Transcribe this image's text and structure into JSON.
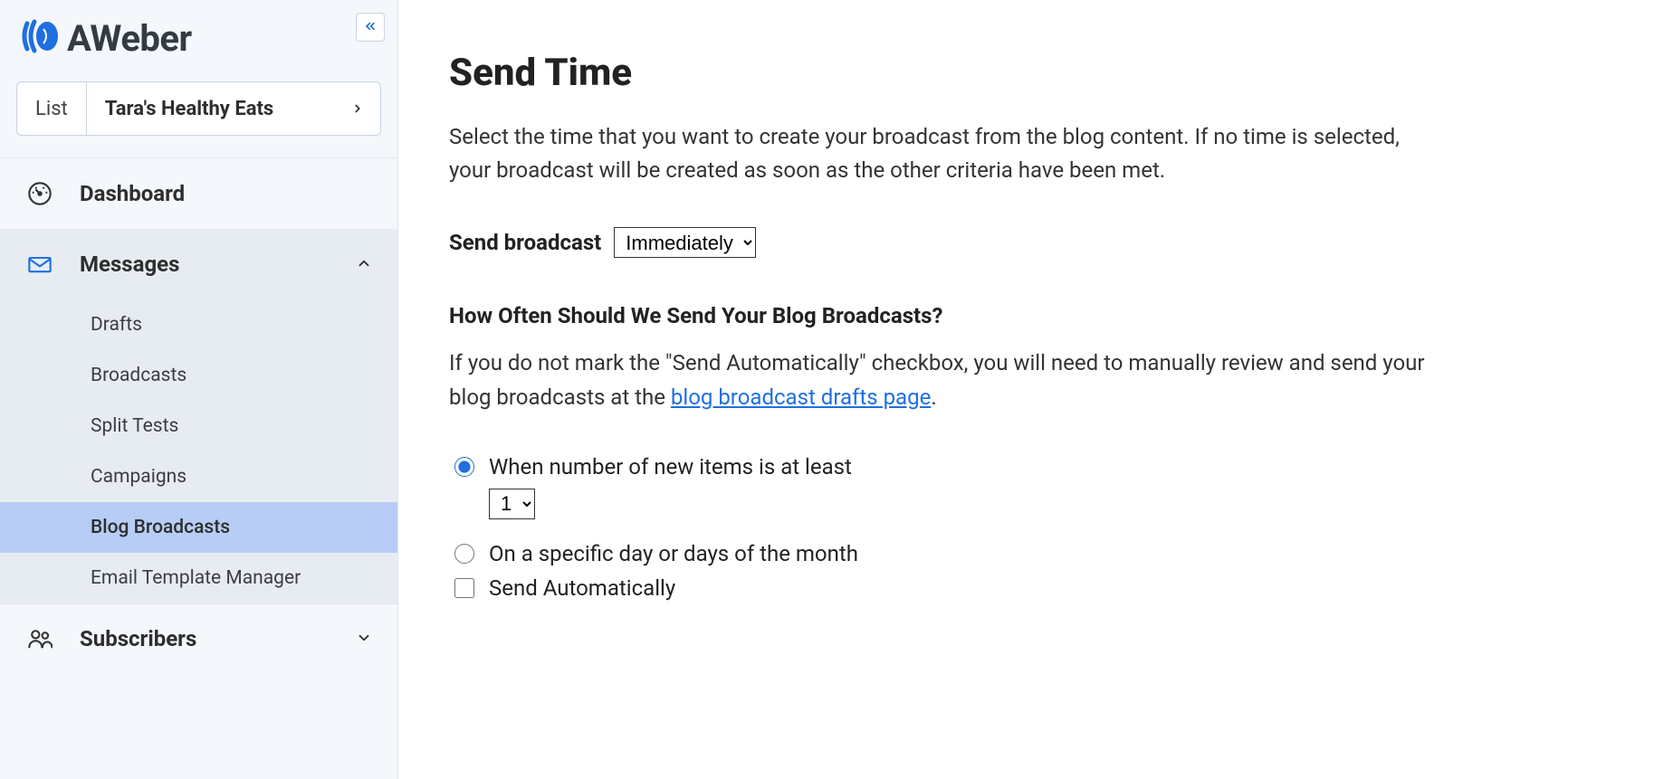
{
  "brand": {
    "name": "AWeber"
  },
  "listSelector": {
    "label": "List",
    "selected": "Tara's Healthy Eats"
  },
  "nav": {
    "dashboard": "Dashboard",
    "messages": "Messages",
    "subscribers": "Subscribers",
    "messagesSub": {
      "drafts": "Drafts",
      "broadcasts": "Broadcasts",
      "splitTests": "Split Tests",
      "campaigns": "Campaigns",
      "blogBroadcasts": "Blog Broadcasts",
      "emailTemplateManager": "Email Template Manager"
    }
  },
  "page": {
    "title": "Send Time",
    "intro": "Select the time that you want to create your broadcast from the blog content. If no time is selected, your broadcast will be created as soon as the other criteria have been met.",
    "sendBroadcastLabel": "Send broadcast",
    "sendBroadcastSelected": "Immediately",
    "howOftenHeading": "How Often Should We Send Your Blog Broadcasts?",
    "howOftenParaPrefix": "If you do not mark the \"Send Automatically\" checkbox, you will need to manually review and send your blog broadcasts at the ",
    "howOftenLinkText": "blog broadcast drafts page",
    "howOftenParaSuffix": ".",
    "optNewItemsLabel": "When number of new items is at least",
    "optNewItemsValue": "1",
    "optSpecificDayLabel": "On a specific day or days of the month",
    "optSendAutoLabel": "Send Automatically"
  }
}
